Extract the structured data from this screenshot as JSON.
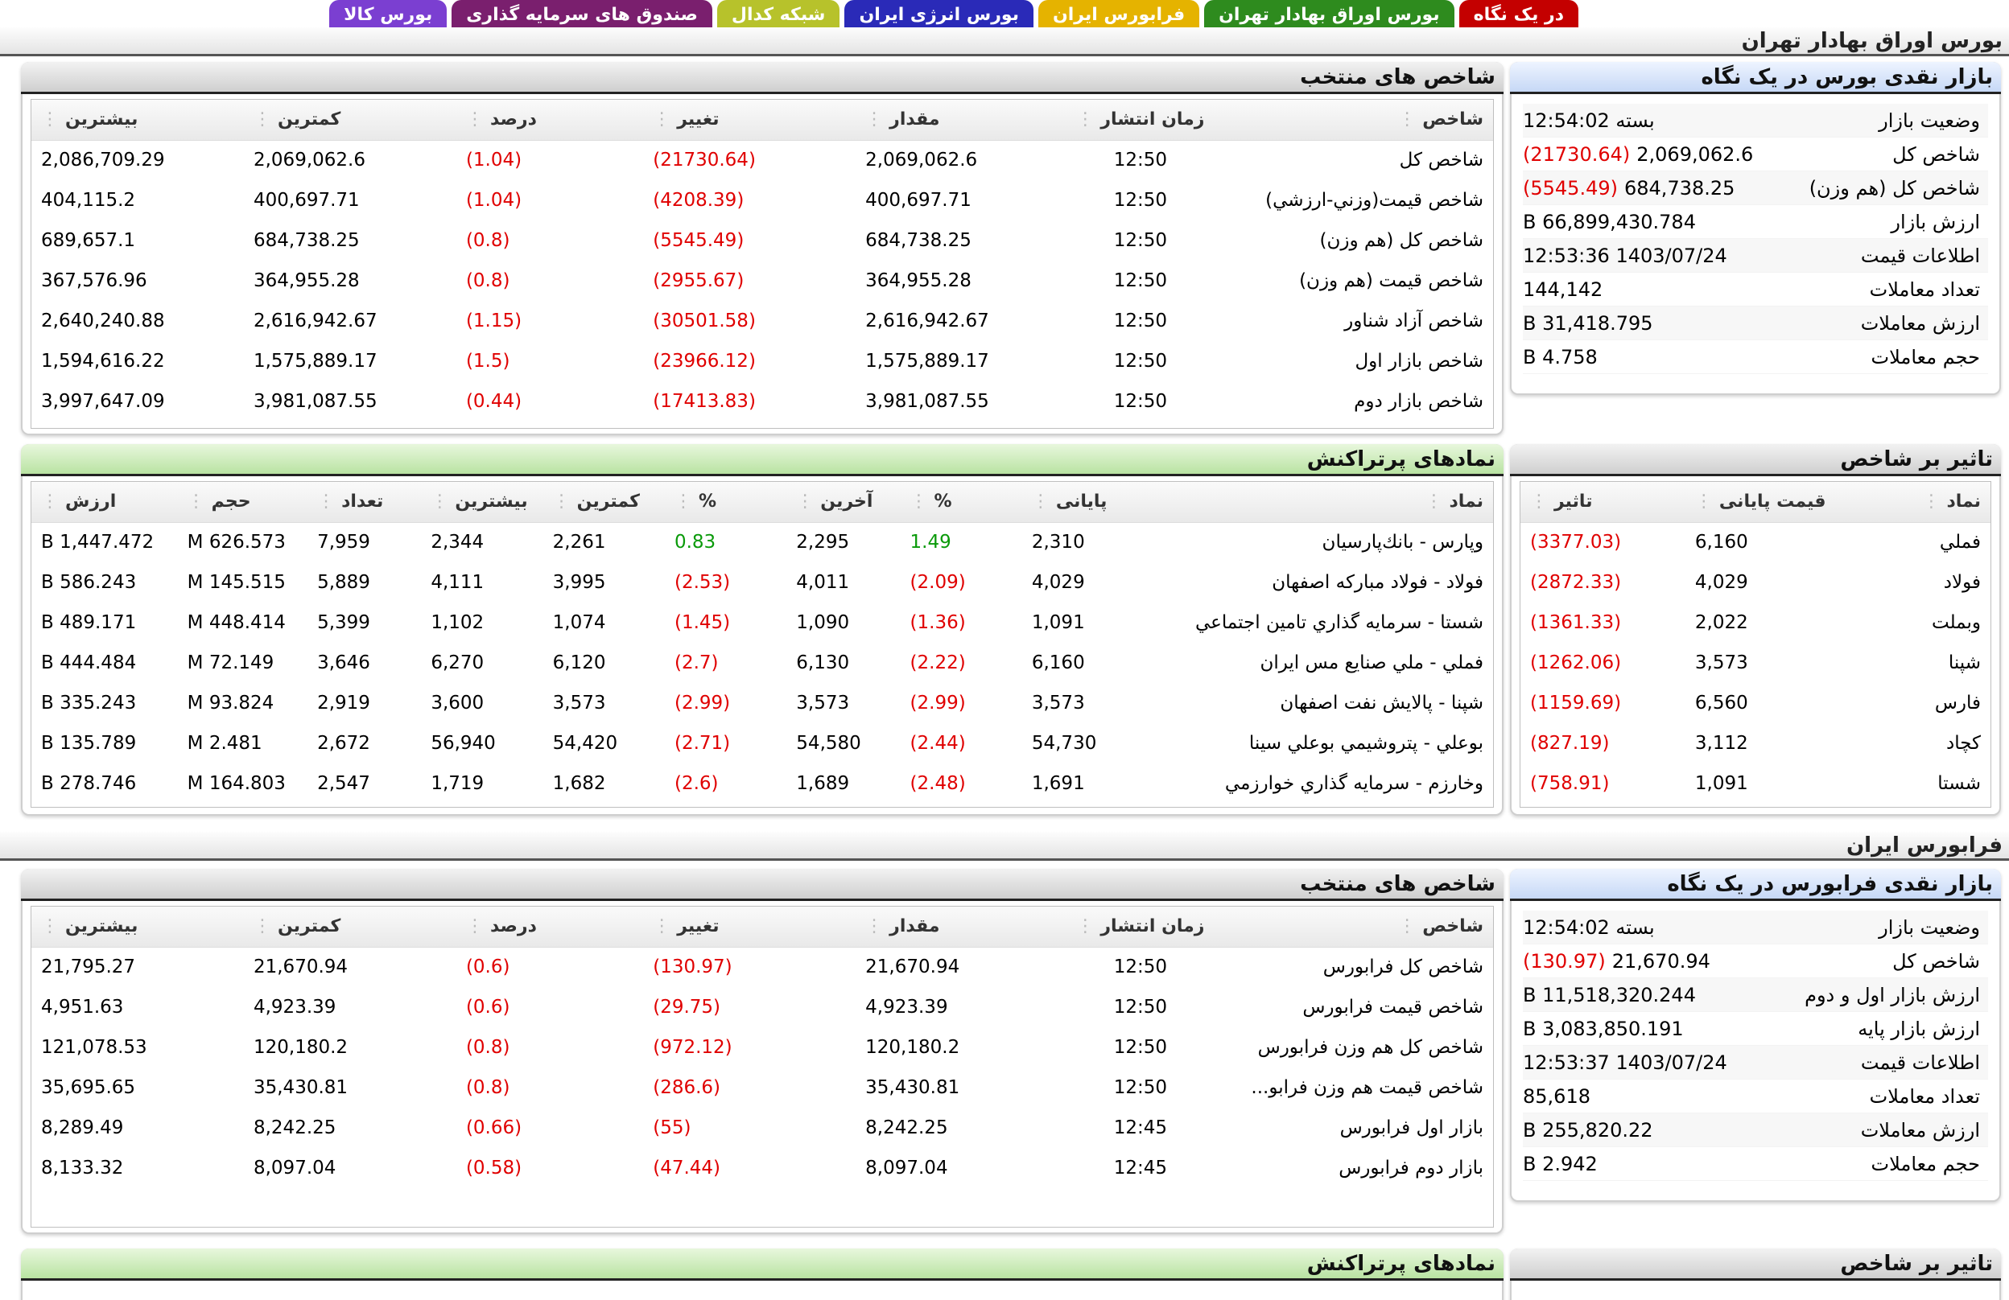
{
  "tabs": [
    {
      "label": "در یک نگاه",
      "bg": "#c40000",
      "fg": "#ffffff"
    },
    {
      "label": "بورس اوراق بهادار تهران",
      "bg": "#2e8b1e",
      "fg": "#ffffff"
    },
    {
      "label": "فرابورس ایران",
      "bg": "#e5b300",
      "fg": "#ffffff"
    },
    {
      "label": "بورس انرژی ایران",
      "bg": "#2a2ab8",
      "fg": "#ffffff"
    },
    {
      "label": "شبکه کدال",
      "bg": "#b7c22b",
      "fg": "#ffffff"
    },
    {
      "label": "صندوق های سرمایه گذاری",
      "bg": "#7a1f6e",
      "fg": "#ffffff"
    },
    {
      "label": "بورس کالا",
      "bg": "#7b3fd1",
      "fg": "#ffffff"
    }
  ],
  "tehran": {
    "section_title": "بورس اوراق بهادار تهران",
    "glance": {
      "title": "بازار نقدی بورس در یک نگاه",
      "rows": [
        {
          "key": "وضعیت بازار",
          "val": "بسته 12:54:02",
          "neg": ""
        },
        {
          "key": "شاخص کل",
          "val": "2,069,062.6",
          "neg": "(21730.64)"
        },
        {
          "key": "شاخص کل (هم وزن)",
          "val": "684,738.25",
          "neg": "(5545.49)"
        },
        {
          "key": "ارزش بازار",
          "val": "66,899,430.784 B",
          "neg": ""
        },
        {
          "key": "اطلاعات قیمت",
          "val": "1403/07/24 12:53:36",
          "neg": ""
        },
        {
          "key": "تعداد معاملات",
          "val": "144,142",
          "neg": ""
        },
        {
          "key": "ارزش معاملات",
          "val": "31,418.795 B",
          "neg": ""
        },
        {
          "key": "حجم معاملات",
          "val": "4.758 B",
          "neg": ""
        }
      ]
    },
    "indices": {
      "title": "شاخص های منتخب",
      "headers": [
        "شاخص",
        "زمان انتشار",
        "مقدار",
        "تغییر",
        "درصد",
        "کمترین",
        "بیشترین"
      ],
      "rows": [
        [
          "شاخص کل",
          "12:50",
          "2,069,062.6",
          "(21730.64)",
          "(1.04)",
          "2,069,062.6",
          "2,086,709.29"
        ],
        [
          "شاخص قيمت(وزني-ارزشي)",
          "12:50",
          "400,697.71",
          "(4208.39)",
          "(1.04)",
          "400,697.71",
          "404,115.2"
        ],
        [
          "شاخص کل (هم وزن)",
          "12:50",
          "684,738.25",
          "(5545.49)",
          "(0.8)",
          "684,738.25",
          "689,657.1"
        ],
        [
          "شاخص قيمت (هم وزن)",
          "12:50",
          "364,955.28",
          "(2955.67)",
          "(0.8)",
          "364,955.28",
          "367,576.96"
        ],
        [
          "شاخص آزاد شناور",
          "12:50",
          "2,616,942.67",
          "(30501.58)",
          "(1.15)",
          "2,616,942.67",
          "2,640,240.88"
        ],
        [
          "شاخص بازار اول",
          "12:50",
          "1,575,889.17",
          "(23966.12)",
          "(1.5)",
          "1,575,889.17",
          "1,594,616.22"
        ],
        [
          "شاخص بازار دوم",
          "12:50",
          "3,981,087.55",
          "(17413.83)",
          "(0.44)",
          "3,981,087.55",
          "3,997,647.09"
        ]
      ]
    },
    "impact": {
      "title": "تاثیر بر شاخص",
      "headers": [
        "نماد",
        "قیمت پایانی",
        "تاثیر"
      ],
      "rows": [
        [
          "فملي",
          "6,160",
          "(3377.03)"
        ],
        [
          "فولاد",
          "4,029",
          "(2872.33)"
        ],
        [
          "وبملت",
          "2,022",
          "(1361.33)"
        ],
        [
          "شپنا",
          "3,573",
          "(1262.06)"
        ],
        [
          "فارس",
          "6,560",
          "(1159.69)"
        ],
        [
          "کچاد",
          "3,112",
          "(827.19)"
        ],
        [
          "شستا",
          "1,091",
          "(758.91)"
        ]
      ]
    },
    "active": {
      "title": "نمادهای پرتراکنش",
      "headers": [
        "نماد",
        "پایانی",
        "%",
        "آخرین",
        "%",
        "کمترین",
        "بیشترین",
        "تعداد",
        "حجم",
        "ارزش"
      ],
      "rows": [
        [
          "وپارس - بانك‌پارسيان",
          "2,310",
          "1.49",
          "2,295",
          "0.83",
          "2,261",
          "2,344",
          "7,959",
          "626.573 M",
          "1,447.472 B"
        ],
        [
          "فولاد - فولاد مباركه اصفهان",
          "4,029",
          "(2.09)",
          "4,011",
          "(2.53)",
          "3,995",
          "4,111",
          "5,889",
          "145.515 M",
          "586.243 B"
        ],
        [
          "شستا - سرمايه گذاري تامين اجتماعي",
          "1,091",
          "(1.36)",
          "1,090",
          "(1.45)",
          "1,074",
          "1,102",
          "5,399",
          "448.414 M",
          "489.171 B"
        ],
        [
          "فملي - ملي صنايع مس ايران",
          "6,160",
          "(2.22)",
          "6,130",
          "(2.7)",
          "6,120",
          "6,270",
          "3,646",
          "72.149 M",
          "444.484 B"
        ],
        [
          "شپنا - پالايش نفت اصفهان",
          "3,573",
          "(2.99)",
          "3,573",
          "(2.99)",
          "3,573",
          "3,600",
          "2,919",
          "93.824 M",
          "335.243 B"
        ],
        [
          "بوعلي - پتروشيمي بوعلي سينا",
          "54,730",
          "(2.44)",
          "54,580",
          "(2.71)",
          "54,420",
          "56,940",
          "2,672",
          "2.481 M",
          "135.789 B"
        ],
        [
          "وخارزم - سرمايه گذاري خوارزمي",
          "1,691",
          "(2.48)",
          "1,689",
          "(2.6)",
          "1,682",
          "1,719",
          "2,547",
          "164.803 M",
          "278.746 B"
        ]
      ]
    }
  },
  "fara": {
    "section_title": "فرابورس ایران",
    "glance": {
      "title": "بازار نقدی فرابورس در یک نگاه",
      "rows": [
        {
          "key": "وضعیت بازار",
          "val": "بسته 12:54:02",
          "neg": ""
        },
        {
          "key": "شاخص کل",
          "val": "21,670.94",
          "neg": "(130.97)"
        },
        {
          "key": "ارزش بازار اول و دوم",
          "val": "11,518,320.244 B",
          "neg": ""
        },
        {
          "key": "ارزش بازار پایه",
          "val": "3,083,850.191 B",
          "neg": ""
        },
        {
          "key": "اطلاعات قیمت",
          "val": "1403/07/24 12:53:37",
          "neg": ""
        },
        {
          "key": "تعداد معاملات",
          "val": "85,618",
          "neg": ""
        },
        {
          "key": "ارزش معاملات",
          "val": "255,820.22 B",
          "neg": ""
        },
        {
          "key": "حجم معاملات",
          "val": "2.942 B",
          "neg": ""
        }
      ]
    },
    "indices": {
      "title": "شاخص های منتخب",
      "headers": [
        "شاخص",
        "زمان انتشار",
        "مقدار",
        "تغییر",
        "درصد",
        "کمترین",
        "بیشترین"
      ],
      "rows": [
        [
          "شاخص كل فرابورس",
          "12:50",
          "21,670.94",
          "(130.97)",
          "(0.6)",
          "21,670.94",
          "21,795.27"
        ],
        [
          "شاخص قيمت فرابورس",
          "12:50",
          "4,923.39",
          "(29.75)",
          "(0.6)",
          "4,923.39",
          "4,951.63"
        ],
        [
          "شاخص کل هم وزن فرابورس",
          "12:50",
          "120,180.2",
          "(972.12)",
          "(0.8)",
          "120,180.2",
          "121,078.53"
        ],
        [
          "شاخص قیمت هم وزن فرابو...",
          "12:50",
          "35,430.81",
          "(286.6)",
          "(0.8)",
          "35,430.81",
          "35,695.65"
        ],
        [
          "بازار اول فرابورس",
          "12:45",
          "8,242.25",
          "(55)",
          "(0.66)",
          "8,242.25",
          "8,289.49"
        ],
        [
          "بازار دوم فرابورس",
          "12:45",
          "8,097.04",
          "(47.44)",
          "(0.58)",
          "8,097.04",
          "8,133.32"
        ]
      ]
    },
    "impact": {
      "title": "تاثیر بر شاخص"
    },
    "active": {
      "title": "نمادهای پرتراکنش"
    }
  }
}
